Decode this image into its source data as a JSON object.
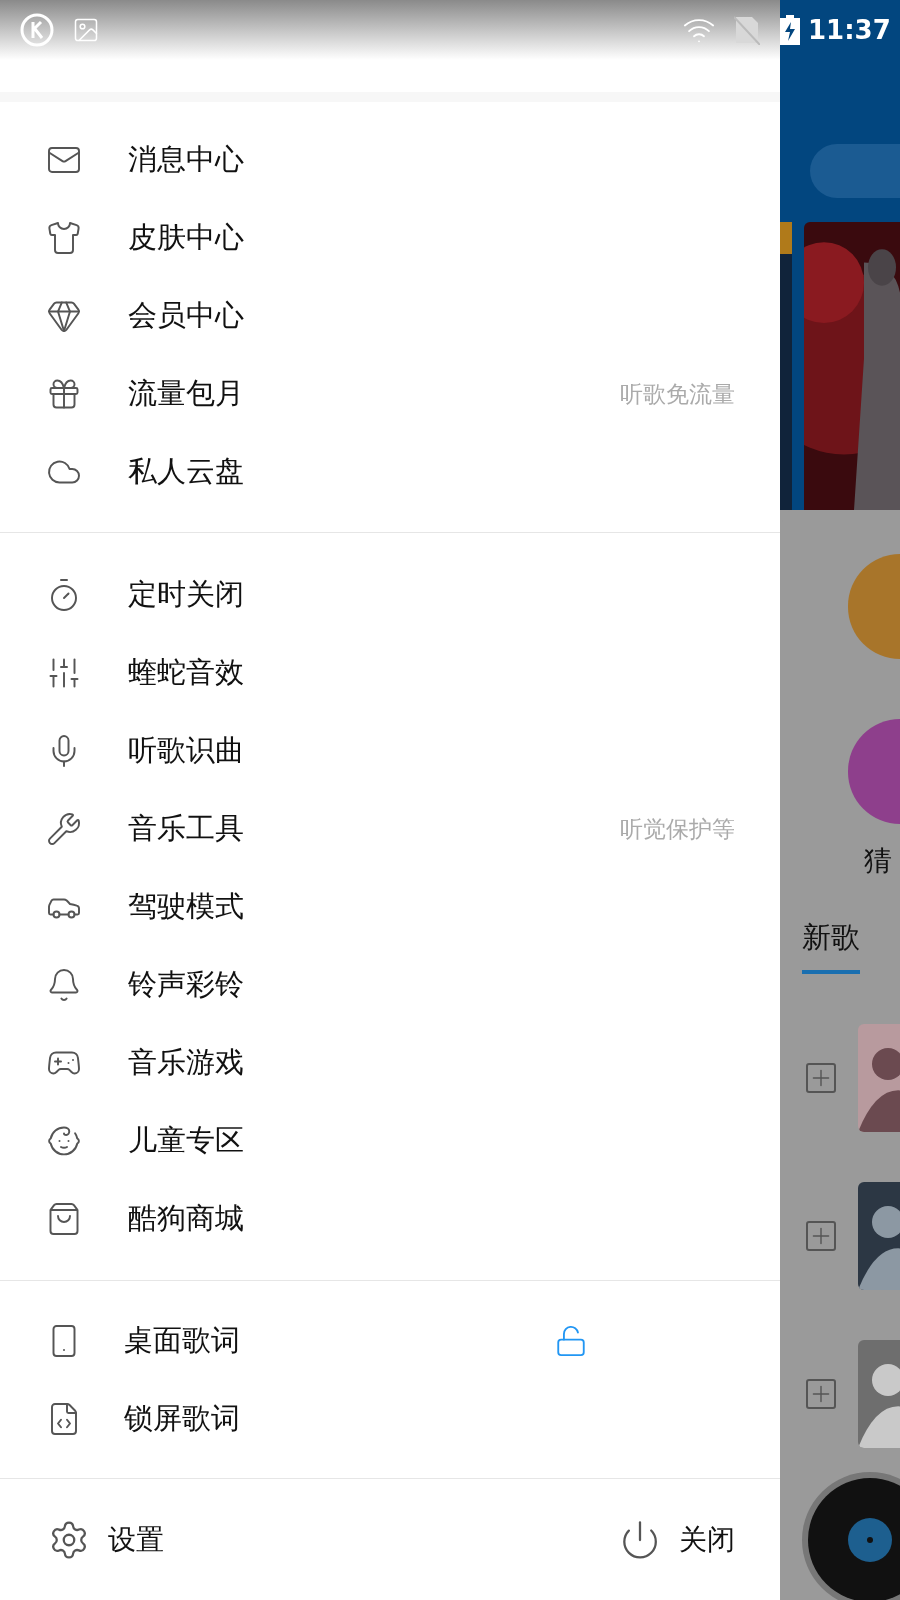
{
  "status_bar": {
    "time": "11:37"
  },
  "menu_sections": [
    {
      "items": [
        {
          "label": "消息中心"
        },
        {
          "label": "皮肤中心"
        },
        {
          "label": "会员中心"
        },
        {
          "label": "流量包月",
          "hint": "听歌免流量"
        },
        {
          "label": "私人云盘"
        }
      ]
    },
    {
      "items": [
        {
          "label": "定时关闭"
        },
        {
          "label": "蝰蛇音效"
        },
        {
          "label": "听歌识曲"
        },
        {
          "label": "音乐工具",
          "hint": "听觉保护等"
        },
        {
          "label": "驾驶模式"
        },
        {
          "label": "铃声彩铃"
        },
        {
          "label": "音乐游戏"
        },
        {
          "label": "儿童专区"
        },
        {
          "label": "酷狗商城"
        }
      ]
    }
  ],
  "lyrics": [
    {
      "label": "桌面歌词",
      "locked": false
    },
    {
      "label": "锁屏歌词"
    }
  ],
  "footer": {
    "settings": "设置",
    "close": "关闭"
  },
  "background": {
    "categories": [
      {
        "label": "猜",
        "color": "#8e3f8c"
      }
    ],
    "tabs": [
      {
        "label": "新歌",
        "selected": true
      }
    ]
  }
}
